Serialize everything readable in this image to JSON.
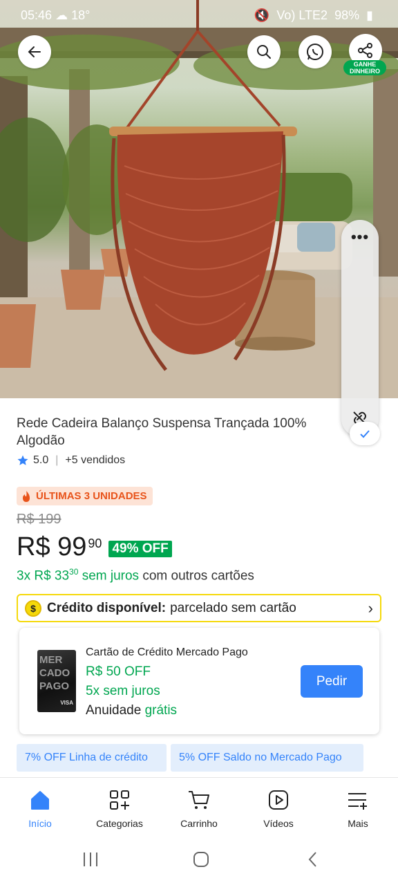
{
  "status_bar": {
    "time": "05:46",
    "temp": "18°",
    "battery": "98%",
    "signal": "Vo) LTE2"
  },
  "top_actions": {
    "share_badge": "GANHE DINHEIRO"
  },
  "product": {
    "title": "Rede Cadeira Balanço Suspensa Trançada 100% Algodão",
    "rating": "5.0",
    "sold": "+5 vendidos",
    "stock_badge": "ÚLTIMAS 3 UNIDADES",
    "old_price": "R$ 199",
    "price_main": "R$ 99",
    "price_cents": "90",
    "discount": "49% OFF",
    "installments_prefix": "3x R$ 33",
    "installments_cents": "30",
    "installments_green": "sem juros",
    "installments_suffix": "com outros cartões"
  },
  "credit": {
    "label_bold": "Crédito disponível:",
    "label_rest": "parcelado sem cartão",
    "coin": "$"
  },
  "card_offer": {
    "title": "Cartão de Crédito Mercado Pago",
    "line1": "R$ 50 OFF",
    "line2": "5x sem juros",
    "line3_prefix": "Anuidade",
    "line3_green": "grátis",
    "button": "Pedir",
    "card_art": "MER CADO PAGO",
    "card_brand": "VISA"
  },
  "chips": [
    "7% OFF Linha de crédito",
    "5% OFF Saldo no Mercado Pago"
  ],
  "bottom_nav": [
    {
      "label": "Início",
      "icon": "home-icon"
    },
    {
      "label": "Categorias",
      "icon": "categories-icon"
    },
    {
      "label": "Carrinho",
      "icon": "cart-icon"
    },
    {
      "label": "Vídeos",
      "icon": "video-icon"
    },
    {
      "label": "Mais",
      "icon": "menu-plus-icon"
    }
  ],
  "colors": {
    "accent": "#3483fa",
    "green": "#00a650",
    "orange": "#e8531a",
    "yellow": "#f5d90a"
  }
}
